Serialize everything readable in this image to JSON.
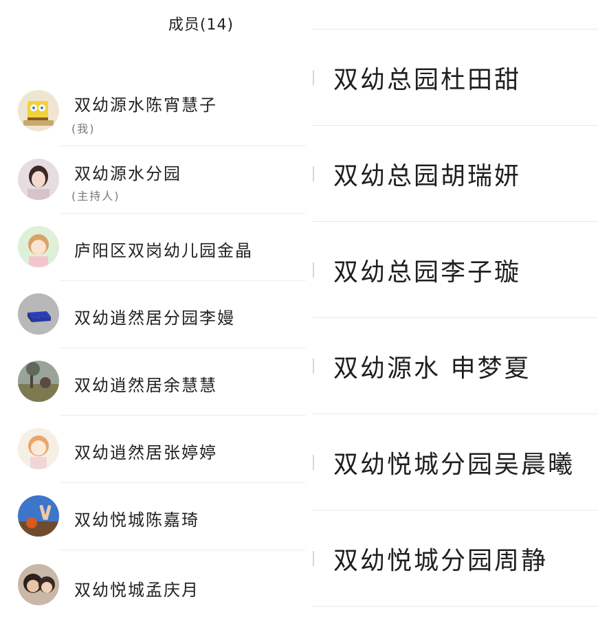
{
  "header": {
    "title": "成员(14)"
  },
  "members": [
    {
      "name": "双幼源水陈宵慧子",
      "tag": "(我)",
      "avatar": "spongebob-avatar"
    },
    {
      "name": "双幼源水分园",
      "tag": "(主持人)",
      "avatar": "girl-photo-avatar"
    },
    {
      "name": "庐阳区双岗幼儿园金晶",
      "tag": "",
      "avatar": "cartoon-girl-avatar"
    },
    {
      "name": "双幼逍然居分园李嫚",
      "tag": "",
      "avatar": "blue-block-avatar"
    },
    {
      "name": "双幼逍然居余慧慧",
      "tag": "",
      "avatar": "landscape-avatar"
    },
    {
      "name": "双幼逍然居张婷婷",
      "tag": "",
      "avatar": "illustration-girl-avatar"
    },
    {
      "name": "双幼悦城陈嘉琦",
      "tag": "",
      "avatar": "peace-sign-avatar"
    },
    {
      "name": "双幼悦城孟庆月",
      "tag": "",
      "avatar": "selfie-avatar"
    }
  ],
  "right_list": [
    {
      "name": "双幼总园杜田甜"
    },
    {
      "name": "双幼总园胡瑞妍"
    },
    {
      "name": "双幼总园李子璇"
    },
    {
      "name": "双幼源水 申梦夏"
    },
    {
      "name": "双幼悦城分园吴晨曦"
    },
    {
      "name": "双幼悦城分园周静"
    }
  ]
}
